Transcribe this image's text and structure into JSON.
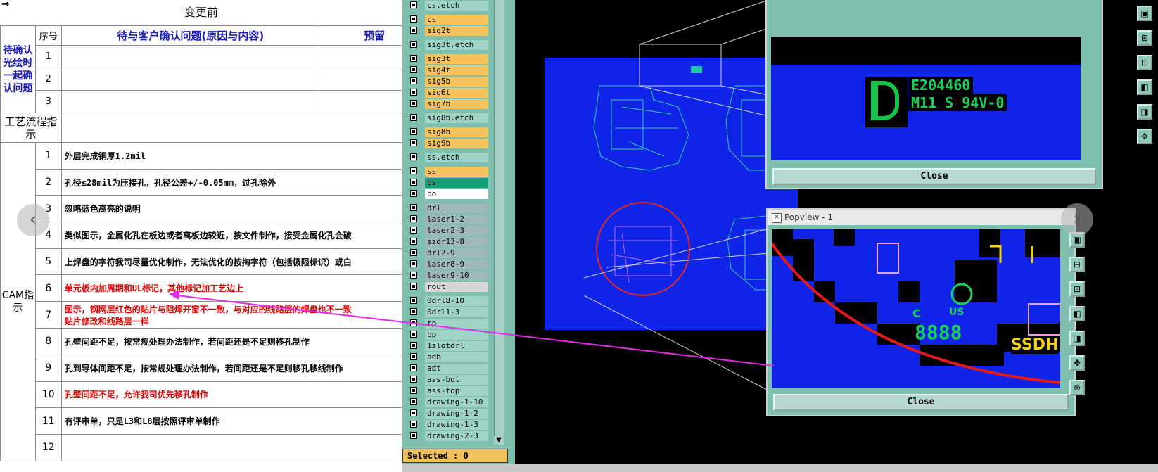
{
  "sheet": {
    "title": "变更前",
    "headers": {
      "no": "序号",
      "issue": "待与客户确认问题(原因与内容)",
      "col3": "预留"
    },
    "side_label_confirm": "待确认光绘时一起确认问题",
    "side_label_process": "工艺流程指示",
    "side_label_cam": "CAM指示",
    "confirm_rows": [
      "1",
      "2",
      "3"
    ],
    "cam_rows": [
      {
        "no": "1",
        "text": "外层完成铜厚1.2mil",
        "color": "black"
      },
      {
        "no": "2",
        "text": "孔径≤28mil为压接孔，孔径公差+/-0.05mm，过孔除外",
        "color": "black"
      },
      {
        "no": "3",
        "text": "忽略蓝色高亮的说明",
        "color": "black"
      },
      {
        "no": "4",
        "text": "类似图示，金属化孔在板边或者离板边较近，按文件制作，接受金属化孔会破",
        "color": "black"
      },
      {
        "no": "5",
        "text": "上焊盘的字符我司尽量优化制作，无法优化的按掏字符（包括极限标识）或白",
        "color": "black"
      },
      {
        "no": "6",
        "text": "单元板内加周期和UL标记，其他标记加工艺边上",
        "color": "red"
      },
      {
        "no": "7",
        "text": "图示，钢网层红色的贴片与阻焊开窗不一致，与对应的线路层的焊盘也不一致",
        "text2": "贴片修改和线路层一样",
        "color": "red"
      },
      {
        "no": "8",
        "text": "孔壁间距不足，按常规处理办法制作，若间距还是不足则移孔制作",
        "color": "black"
      },
      {
        "no": "9",
        "text": "孔到导体间距不足，按常规处理办法制作，若间距还是不足则移孔移线制作",
        "color": "black"
      },
      {
        "no": "10",
        "text": "孔壁间距不足，允许我司优先移孔制作",
        "color": "red"
      },
      {
        "no": "11",
        "text": "有评审单，只是L3和L8层按照评审单制作",
        "color": "black"
      },
      {
        "no": "12",
        "text": "",
        "color": "black"
      }
    ],
    "nav_prev": "‹",
    "nav_next": "›",
    "corner_arrow": "⇒"
  },
  "layers": {
    "items": [
      {
        "name": "cs.etch",
        "color": "#9fd3c7",
        "gap_after": true
      },
      {
        "name": "cs",
        "color": "#f5c35d"
      },
      {
        "name": "sig2t",
        "color": "#f5c35d",
        "gap_after": true
      },
      {
        "name": "sig3t.etch",
        "color": "#9fd3c7",
        "gap_after": true
      },
      {
        "name": "sig3t",
        "color": "#f5c35d"
      },
      {
        "name": "sig4t",
        "color": "#f5c35d"
      },
      {
        "name": "sig5b",
        "color": "#f5c35d"
      },
      {
        "name": "sig6t",
        "color": "#f5c35d"
      },
      {
        "name": "sig7b",
        "color": "#f5c35d",
        "gap_after": true
      },
      {
        "name": "sig8b.etch",
        "color": "#9fd3c7",
        "gap_after": true
      },
      {
        "name": "sig8b",
        "color": "#f5c35d"
      },
      {
        "name": "sig9b",
        "color": "#f5c35d",
        "gap_after": true
      },
      {
        "name": "ss.etch",
        "color": "#9fd3c7",
        "gap_after": true
      },
      {
        "name": "ss",
        "color": "#f5c35d"
      },
      {
        "name": "bs",
        "color": "#12a07a"
      },
      {
        "name": "bo",
        "color": "#ffffff",
        "gap_after": true
      },
      {
        "name": "drl",
        "color": "#9fb8bc"
      },
      {
        "name": "laser1-2",
        "color": "#9fb8bc"
      },
      {
        "name": "laser2-3",
        "color": "#9fb8bc"
      },
      {
        "name": "szdr13-8",
        "color": "#9fb8bc"
      },
      {
        "name": "drl2-9",
        "color": "#9fb8bc"
      },
      {
        "name": "laser8-9",
        "color": "#9fb8bc"
      },
      {
        "name": "laser9-10",
        "color": "#9fb8bc"
      },
      {
        "name": "rout",
        "color": "#d8d8d8",
        "gap_after": true
      },
      {
        "name": "0drl8-10",
        "color": "#9fd3c7"
      },
      {
        "name": "0drl1-3",
        "color": "#9fd3c7"
      },
      {
        "name": "tp",
        "color": "#9fd3c7"
      },
      {
        "name": "bp",
        "color": "#9fd3c7"
      },
      {
        "name": "1slotdrl",
        "color": "#9fd3c7"
      },
      {
        "name": "adb",
        "color": "#9fd3c7"
      },
      {
        "name": "adt",
        "color": "#9fd3c7"
      },
      {
        "name": "ass-bot",
        "color": "#9fd3c7"
      },
      {
        "name": "ass-top",
        "color": "#9fd3c7"
      },
      {
        "name": "drawing-1-10",
        "color": "#9fd3c7"
      },
      {
        "name": "drawing-1-2",
        "color": "#9fd3c7"
      },
      {
        "name": "drawing-1-3",
        "color": "#9fd3c7"
      },
      {
        "name": "drawing-2-3",
        "color": "#9fd3c7"
      }
    ],
    "status": "Selected : 0"
  },
  "popup_top": {
    "close_label": "Close",
    "ul_text_line1": "E204460",
    "ul_text_line2": "M11 S 94V-0"
  },
  "popup_bottom": {
    "title": "Popview - 1",
    "close_label": "Close",
    "marking_c": "C",
    "marking_us": "US",
    "marking_date": "8888",
    "marking_right": "SSDH"
  },
  "colors": {
    "board_blue": "#1024e8",
    "panel_teal": "#7fbfb0",
    "annotation_magenta": "#e52ae5",
    "highlight_red": "#e00000"
  }
}
